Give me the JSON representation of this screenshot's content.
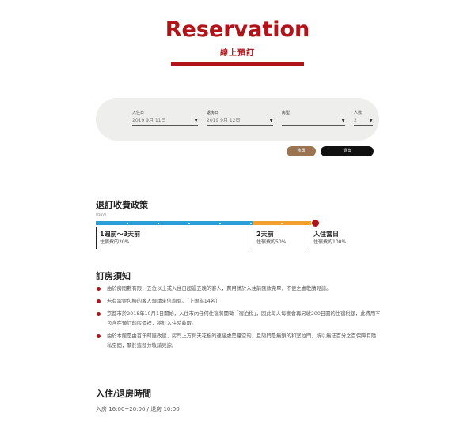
{
  "header": {
    "title": "Reservation",
    "subtitle": "線上預訂"
  },
  "search": {
    "checkin_label": "入住日",
    "checkin_value": "2019 9月 11日",
    "checkout_label": "退房日",
    "checkout_value": "2019 9月 12日",
    "room_type_label": "房型",
    "room_type_value": "",
    "guests_label": "人數",
    "guests_value": "2",
    "caret": "▼",
    "search_button": "搜尋",
    "cancel_button": "退出"
  },
  "policy": {
    "heading": "退訂收費政策",
    "unit": "(day)",
    "tiers": [
      {
        "name": "1週前～3天前",
        "fee": "住宿費的20%"
      },
      {
        "name": "2天前",
        "fee": "住宿費的50%"
      },
      {
        "name": "入住當日",
        "fee": "住宿費的100%"
      }
    ],
    "colors": {
      "early": "#2aa0d6",
      "mid": "#f0a02c",
      "final": "#b0141a"
    }
  },
  "notes": {
    "heading": "訂房須知",
    "items": [
      "由於房間數有限，五位以上或入住日超過五晚的客人，費用請於入住前匯款完畢，不便之處敬請見諒。",
      "若有需要包棟的客人煩請來信詢問。（上限為14名）",
      "京都市於2018年10月1日開始，入住市內任何住宿將開徵「宿泊稅」，因此每人每晚會再另收200日圓的住宿稅額，此費用不包含在預訂的房價裡，將於入住時收取。",
      "由於本館是由百年町屋改建，房門上方與天花板的連接處是鏤空的，且隔門是無鎖的和室拉門，所以無法百分之百保障有隱私空間，關於這部分敬請見諒。"
    ]
  },
  "checkin": {
    "heading": "入住/退房時間",
    "text": "入房 16:00~20:00 / 退房 10:00"
  },
  "colors": {
    "brand": "#b0141a",
    "panel": "#eeeeed",
    "search_btn": "#9a7450",
    "cancel_btn": "#111111"
  }
}
